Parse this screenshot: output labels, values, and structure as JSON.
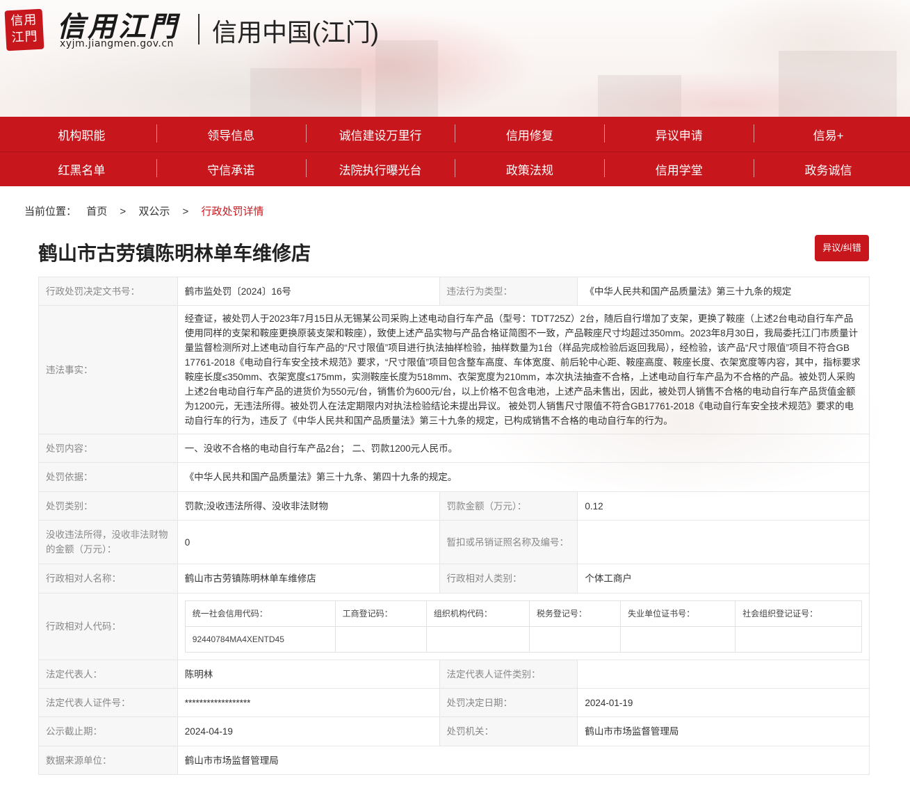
{
  "header": {
    "seal_text": "信用江門",
    "logo_text": "信用江門",
    "url": "xyjm.jiangmen.gov.cn",
    "subtitle": "信用中国(江门)"
  },
  "nav": {
    "row1": [
      "机构职能",
      "领导信息",
      "诚信建设万里行",
      "信用修复",
      "异议申请",
      "信易+"
    ],
    "row2": [
      "红黑名单",
      "守信承诺",
      "法院执行曝光台",
      "政策法规",
      "信用学堂",
      "政务诚信"
    ]
  },
  "breadcrumb": {
    "label": "当前位置：",
    "items": [
      "首页",
      "双公示",
      "行政处罚详情"
    ],
    "sep": ">"
  },
  "page_title": "鹤山市古劳镇陈明林单车维修店",
  "objection_button": "异议/纠错",
  "detail": {
    "doc_no_label": "行政处罚决定文书号：",
    "doc_no": "鹤市监处罚〔2024〕16号",
    "violation_type_label": "违法行为类型：",
    "violation_type": "《中华人民共和国产品质量法》第三十九条的规定",
    "facts_label": "违法事实：",
    "facts": "经查证，被处罚人于2023年7月15日从无锡某公司采购上述电动自行车产品（型号：TDT725Z）2台，随后自行增加了支架，更换了鞍座（上述2台电动自行车产品使用同样的支架和鞍座更换原装支架和鞍座），致使上述产品实物与产品合格证简图不一致，产品鞍座尺寸均超过350mm。2023年8月30日，我局委托江门市质量计量监督检测所对上述电动自行车产品的“尺寸限值”项目进行执法抽样检验，抽样数量为1台（样品完成检验后返回我局），经检验，该产品“尺寸限值”项目不符合GB 17761-2018《电动自行车安全技术规范》要求，“尺寸限值”项目包含整车高度、车体宽度、前后轮中心距、鞍座高度、鞍座长度、衣架宽度等内容，其中，指标要求鞍座长度≤350mm、衣架宽度≤175mm，实测鞍座长度为518mm、衣架宽度为210mm，本次执法抽查不合格，上述电动自行车产品为不合格的产品。被处罚人采购上述2台电动自行车产品的进货价为550元/台，销售价为600元/台，以上价格不包含电池，上述产品未售出，因此，被处罚人销售不合格的电动自行车产品货值金额为1200元，无违法所得。被处罚人在法定期限内对执法检验结论未提出异议。 被处罚人销售尺寸限值不符合GB17761-2018《电动自行车安全技术规范》要求的电动自行车的行为，违反了《中华人民共和国产品质量法》第三十九条的规定，已构成销售不合格的电动自行车的行为。",
    "penalty_content_label": "处罚内容：",
    "penalty_content": "一、没收不合格的电动自行车产品2台； 二、罚款1200元人民币。",
    "penalty_basis_label": "处罚依据：",
    "penalty_basis": "《中华人民共和国产品质量法》第三十九条、第四十九条的规定。",
    "penalty_category_label": "处罚类别：",
    "penalty_category": "罚款;没收违法所得、没收非法财物",
    "fine_amount_label": "罚款金额（万元）：",
    "fine_amount": "0.12",
    "confiscated_label": "没收违法所得，没收非法财物的金额（万元）：",
    "confiscated": "0",
    "suspend_label": "暂扣或吊销证照名称及编号：",
    "suspend": "",
    "party_name_label": "行政相对人名称：",
    "party_name": "鹤山市古劳镇陈明林单车维修店",
    "party_type_label": "行政相对人类别：",
    "party_type": "个体工商户",
    "party_code_label": "行政相对人代码：",
    "codes_headers": [
      "统一社会信用代码：",
      "工商登记码：",
      "组织机构代码：",
      "税务登记号：",
      "失业单位证书号：",
      "社会组织登记证号："
    ],
    "codes_values": [
      "92440784MA4XENTD45",
      "",
      "",
      "",
      "",
      ""
    ],
    "legal_rep_label": "法定代表人：",
    "legal_rep": "陈明林",
    "legal_rep_id_type_label": "法定代表人证件类别：",
    "legal_rep_id_type": "",
    "legal_rep_id_label": "法定代表人证件号：",
    "legal_rep_id": "******************",
    "decision_date_label": "处罚决定日期：",
    "decision_date": "2024-01-19",
    "publish_deadline_label": "公示截止期：",
    "publish_deadline": "2024-04-19",
    "authority_label": "处罚机关：",
    "authority": "鹤山市市场监督管理局",
    "source_label": "数据来源单位：",
    "source": "鹤山市市场监督管理局"
  }
}
